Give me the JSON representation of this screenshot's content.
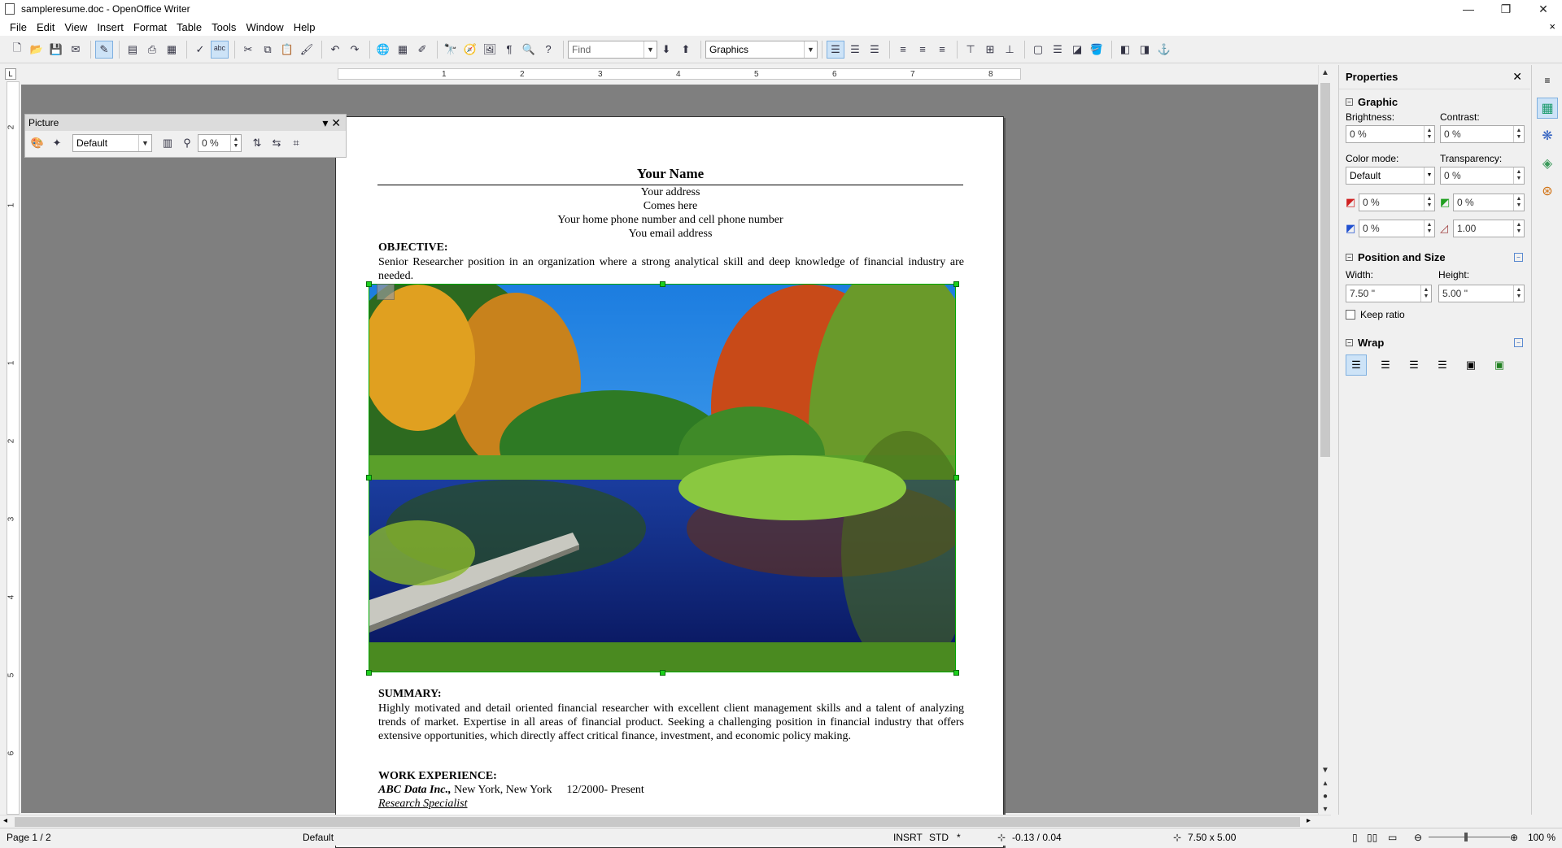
{
  "window": {
    "title": "sampleresume.doc - OpenOffice Writer",
    "minimize": "—",
    "restore": "❐",
    "close": "✕"
  },
  "menu": [
    "File",
    "Edit",
    "View",
    "Insert",
    "Format",
    "Table",
    "Tools",
    "Window",
    "Help"
  ],
  "menu_close": "×",
  "toolbar": {
    "find_placeholder": "Find",
    "style_value": "Graphics"
  },
  "ruler": {
    "h_numbers": [
      "1",
      "2",
      "3",
      "4",
      "5",
      "6",
      "7",
      "8"
    ],
    "v_numbers": [
      "2",
      "1",
      "1",
      "2",
      "3",
      "4",
      "5",
      "6"
    ],
    "corner": "L"
  },
  "picture_toolbar": {
    "title": "Picture",
    "mode_value": "Default",
    "transparency_value": "0 %"
  },
  "document": {
    "name": "Your Name",
    "address1": "Your address",
    "address2": "Comes here",
    "phone": "Your home phone number and cell phone number",
    "email": "You email address",
    "objective_heading": "OBJECTIVE:",
    "objective_text": "Senior Researcher position in an organization where a strong analytical skill and deep knowledge of financial industry are needed.",
    "summary_heading": "SUMMARY:",
    "summary_text": "Highly motivated and detail oriented financial researcher with excellent client management skills and a talent of analyzing trends of market.   Expertise in all areas of financial product.  Seeking a challenging position in financial industry that offers extensive opportunities, which directly affect critical finance, investment, and economic policy making.",
    "work_heading": "WORK EXPERIENCE:",
    "company": "ABC Data Inc.,",
    "location": " New York, New York",
    "dates": "12/2000- Present",
    "role": "Research Specialist"
  },
  "properties": {
    "title": "Properties",
    "graphic_heading": "Graphic",
    "brightness_label": "Brightness:",
    "brightness_value": "0 %",
    "contrast_label": "Contrast:",
    "contrast_value": "0 %",
    "color_mode_label": "Color mode:",
    "color_mode_value": "Default",
    "transparency_label": "Transparency:",
    "transparency_value": "0 %",
    "red_value": "0 %",
    "green_value": "0 %",
    "blue_value": "0 %",
    "gamma_value": "1.00",
    "pos_heading": "Position and Size",
    "width_label": "Width:",
    "width_value": "7.50 \"",
    "height_label": "Height:",
    "height_value": "5.00 \"",
    "keep_ratio_label": "Keep ratio",
    "wrap_heading": "Wrap"
  },
  "status": {
    "page": "Page 1 / 2",
    "style": "Default",
    "insert_mode": "INSRT",
    "selection_mode": "STD",
    "modified": "*",
    "position": "-0.13 / 0.04",
    "size": "7.50 x 5.00",
    "zoom": "100 %"
  }
}
